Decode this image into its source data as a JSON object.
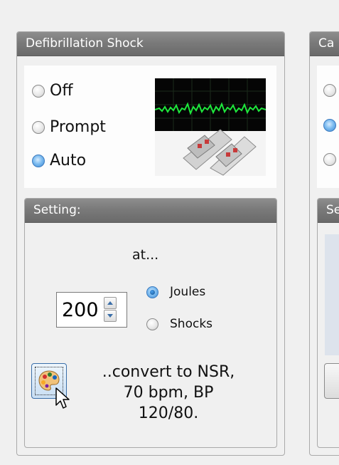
{
  "defib_panel": {
    "title": "Defibrillation Shock",
    "mode_options": [
      {
        "label": "Off",
        "checked": false
      },
      {
        "label": "Prompt",
        "checked": false
      },
      {
        "label": "Auto",
        "checked": true
      }
    ],
    "image_icon": "monitor-with-defibrillator-paddles-icon"
  },
  "setting_panel": {
    "title": "Setting:",
    "at_label": "at...",
    "energy_value": "200",
    "unit_options": [
      {
        "label": "Joules",
        "checked": true
      },
      {
        "label": "Shocks",
        "checked": false
      }
    ],
    "convert_button_icon": "palette-icon",
    "convert_text_lines": [
      "..convert to NSR,",
      "70 bpm, BP",
      "120/80."
    ]
  },
  "right_panel": {
    "title_fragment": "Ca",
    "mode_options": [
      {
        "checked": false
      },
      {
        "checked": true
      },
      {
        "checked": false
      }
    ],
    "setting_title_fragment": "Se"
  },
  "colors": {
    "ecg_line": "#1ee83c",
    "monitor_bg": "#050505",
    "radio_selected": "#3b8ad6"
  }
}
